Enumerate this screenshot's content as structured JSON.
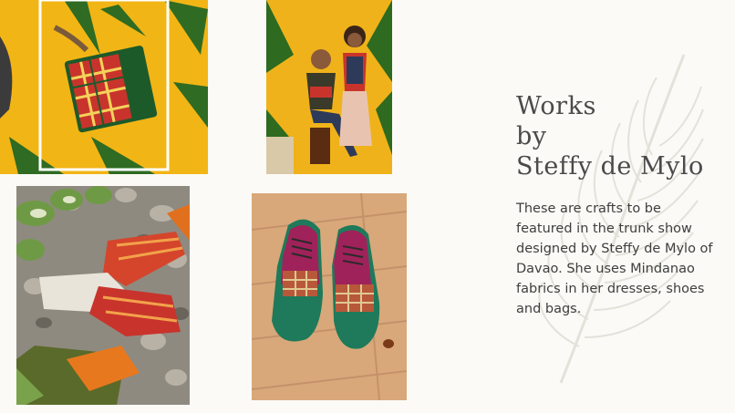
{
  "slide": {
    "title_lines": [
      "Works",
      "by",
      "Steffy de Mylo"
    ],
    "body": "These are crafts to be featured in the trunk show designed by Steffy de Mylo of Davao. She uses Mindanao fabrics in her dresses, shoes and bags."
  },
  "photos": [
    {
      "name": "plaid-handbag-photo",
      "icon": "handbag-photo"
    },
    {
      "name": "two-women-photo",
      "icon": "portrait-photo"
    },
    {
      "name": "slippers-on-pebbles-photo",
      "icon": "slipper-photo"
    },
    {
      "name": "green-oxford-shoes-photo",
      "icon": "shoe-photo"
    }
  ],
  "colors": {
    "background": "#fbfaf6",
    "text": "#3e3e3e",
    "yellow": "#f2b516",
    "shoe_green": "#1e7a5a",
    "shoe_magenta": "#a0225a"
  }
}
